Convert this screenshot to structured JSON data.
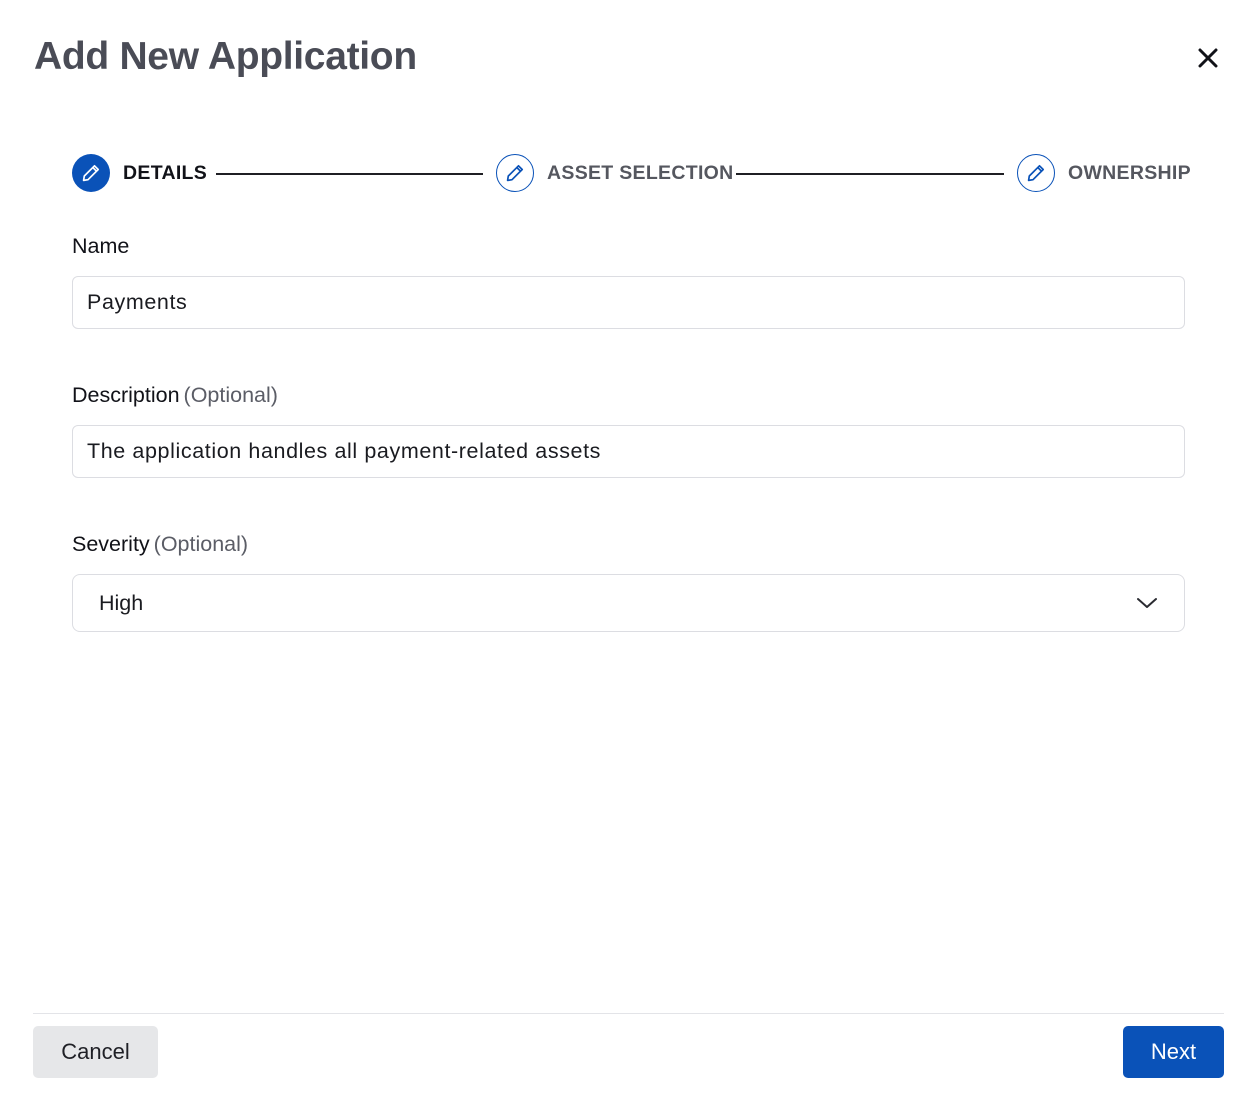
{
  "modal": {
    "title": "Add New Application"
  },
  "stepper": {
    "steps": [
      {
        "label": "DETAILS",
        "state": "active",
        "icon": "pencil-icon"
      },
      {
        "label": "ASSET SELECTION",
        "state": "inactive",
        "icon": "pencil-icon"
      },
      {
        "label": "OWNERSHIP",
        "state": "inactive",
        "icon": "pencil-icon"
      }
    ]
  },
  "form": {
    "name": {
      "label": "Name",
      "value": "Payments"
    },
    "description": {
      "label": "Description",
      "optional": "(Optional)",
      "value": "The application handles all payment-related assets"
    },
    "severity": {
      "label": "Severity",
      "optional": "(Optional)",
      "value": "High",
      "icon": "chevron-down-icon"
    }
  },
  "footer": {
    "cancel_label": "Cancel",
    "next_label": "Next"
  },
  "colors": {
    "primary": "#0a52b8",
    "title": "#4a4c56",
    "border": "#dcdde2",
    "cancel_bg": "#e6e7e9"
  }
}
